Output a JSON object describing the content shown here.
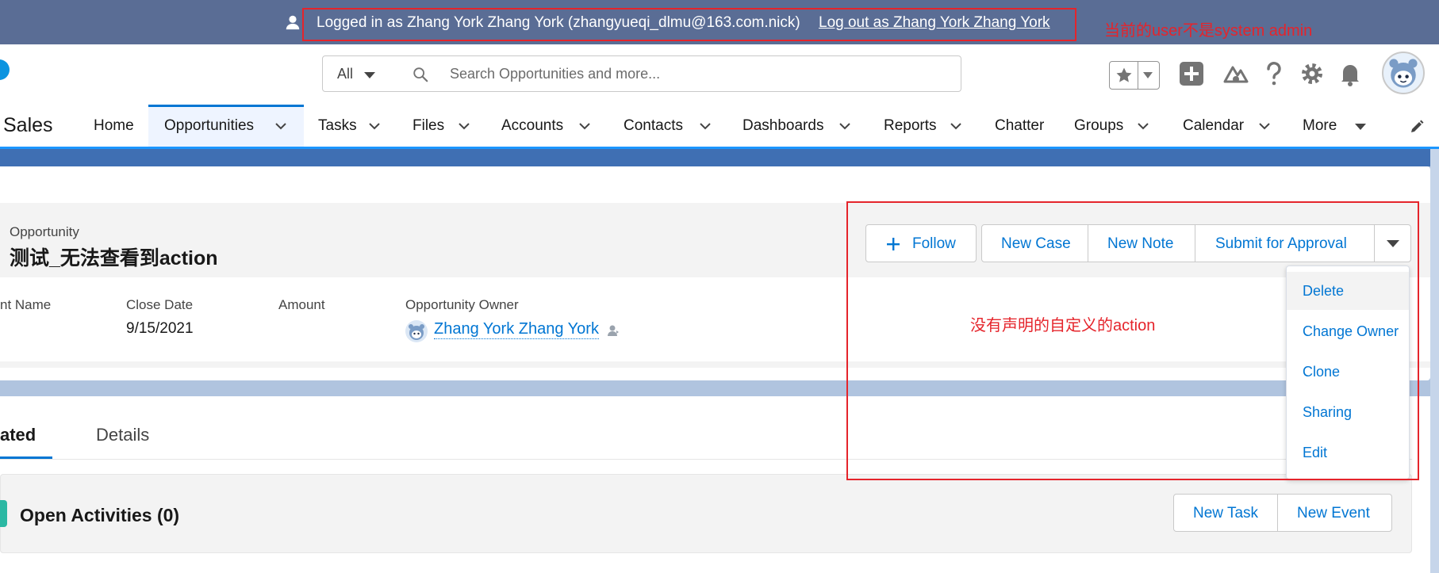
{
  "impersonation": {
    "text": "Logged in as Zhang York Zhang York (zhangyueqi_dlmu@163.com.nick)",
    "logout_link": "Log out as Zhang York Zhang York"
  },
  "annotations": {
    "top_note": "当前的user不是system admin",
    "action_note": "没有声明的自定义的action"
  },
  "search": {
    "scope": "All",
    "placeholder": "Search Opportunities and more..."
  },
  "nav": {
    "app_name": "Sales",
    "items": [
      "Home",
      "Opportunities",
      "Tasks",
      "Files",
      "Accounts",
      "Contacts",
      "Dashboards",
      "Reports",
      "Chatter",
      "Groups",
      "Calendar",
      "More"
    ],
    "active": "Opportunities"
  },
  "record": {
    "object_label": "Opportunity",
    "title": "测试_无法查看到action",
    "actions": {
      "follow": "Follow",
      "new_case": "New Case",
      "new_note": "New Note",
      "submit_for_approval": "Submit for Approval"
    },
    "menu_items": [
      "Delete",
      "Change Owner",
      "Clone",
      "Sharing",
      "Edit"
    ],
    "fields": {
      "account_name_label": "nt Name",
      "close_date_label": "Close Date",
      "close_date_value": "9/15/2021",
      "amount_label": "Amount",
      "owner_label": "Opportunity Owner",
      "owner_value": "Zhang York Zhang York"
    }
  },
  "tabs": {
    "related": "ated",
    "details": "Details"
  },
  "activities": {
    "title": "Open Activities (0)",
    "new_task": "New Task",
    "new_event": "New Event"
  },
  "colors": {
    "brand_blue": "#0176d3",
    "annotation_red": "#e5242b",
    "impersonation_bar": "#5a6d95"
  }
}
